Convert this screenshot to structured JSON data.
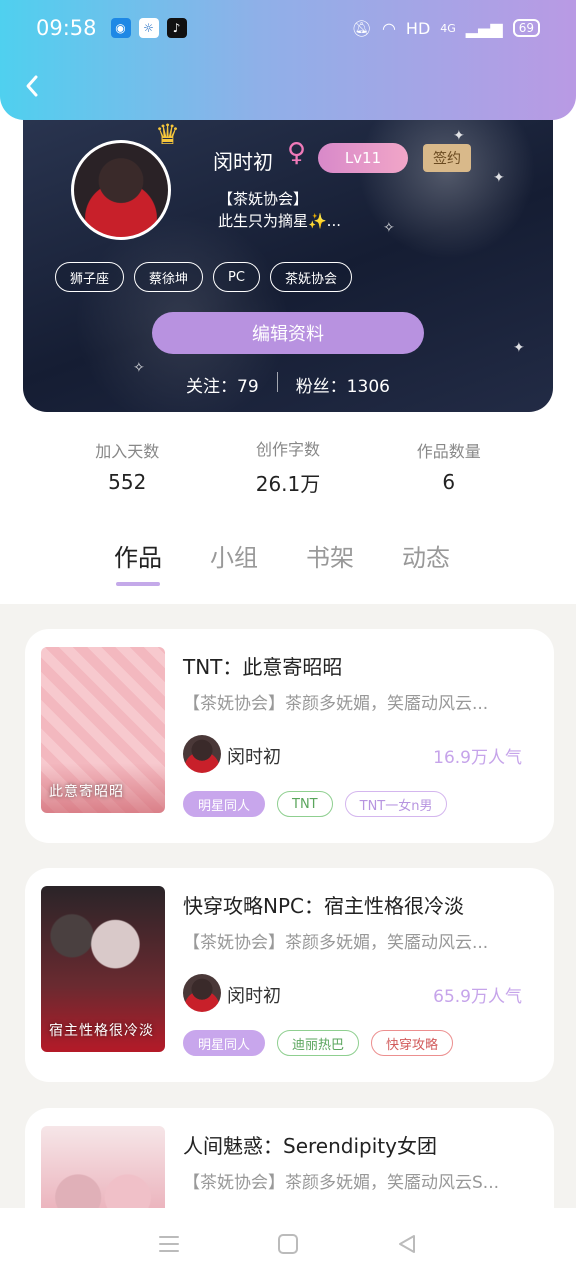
{
  "status_bar": {
    "time": "09:58",
    "network": "HD",
    "signal": "4G",
    "battery": "69"
  },
  "profile": {
    "username": "闵时初",
    "level": "Lv11",
    "signed": "签约",
    "bio": "【茶妩协会】\n此生只为摘星✨...",
    "tags": [
      "狮子座",
      "蔡徐坤",
      "PC",
      "茶妩协会"
    ],
    "edit_button": "编辑资料",
    "following_label": "关注：79",
    "followers_label": "粉丝：1306",
    "accent_color": "#b892e0"
  },
  "stats": [
    {
      "label": "加入天数",
      "value": "552"
    },
    {
      "label": "创作字数",
      "value": "26.1万"
    },
    {
      "label": "作品数量",
      "value": "6"
    }
  ],
  "tabs": [
    {
      "label": "作品",
      "active": true
    },
    {
      "label": "小组",
      "active": false
    },
    {
      "label": "书架",
      "active": false
    },
    {
      "label": "动态",
      "active": false
    }
  ],
  "works": [
    {
      "title": "TNT：此意寄昭昭",
      "desc": "【茶妩协会】茶颜多妩媚，笑靥动风云...",
      "author": "闵时初",
      "popularity": "16.9万人气",
      "tags": [
        "明星同人",
        "TNT",
        "TNT一女n男"
      ],
      "cover_text": "此意寄昭昭"
    },
    {
      "title": "快穿攻略NPC：宿主性格很冷淡",
      "desc": "【茶妩协会】茶颜多妩媚，笑靥动风云...",
      "author": "闵时初",
      "popularity": "65.9万人气",
      "tags": [
        "明星同人",
        "迪丽热巴",
        "快穿攻略"
      ],
      "cover_text": "宿主性格很冷淡"
    },
    {
      "title": "人间魅惑：Serendipity女团",
      "desc": "【茶妩协会】茶颜多妩媚，笑靥动风云S..."
    }
  ]
}
